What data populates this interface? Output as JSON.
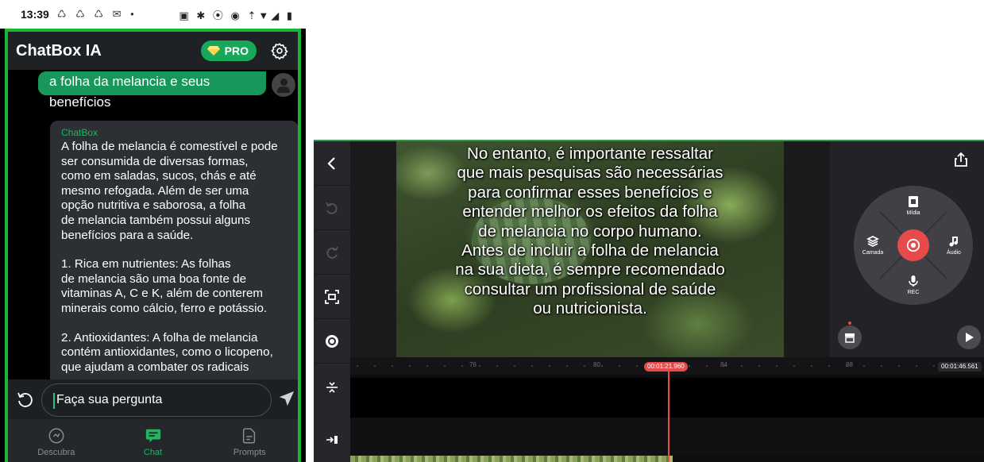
{
  "phone": {
    "status_bar": {
      "time": "13:39",
      "notifications": "♺ ♺ ♺ ✉ •",
      "system": "▣ ✱ ⦿ ◉ ⇡▼◢ ▮"
    },
    "app_bar": {
      "title": "ChatBox IA",
      "pro_label": "PRO"
    },
    "messages": {
      "user": "a folha da melancia e seus benefícios",
      "bot_sender": "ChatBox",
      "bot_paragraphs": [
        "A folha de melancia é comestível e pode\nser consumida de diversas formas,\ncomo em saladas, sucos, chás e até\nmesmo refogada. Além de ser uma\nopção nutritiva e saborosa, a folha\nde melancia também possui alguns\nbenefícios para a saúde.",
        "1. Rica em nutrientes: As folhas\nde melancia são uma boa fonte de\nvitaminas A, C e K, além de conterem\nminerais como cálcio, ferro e potássio.",
        "2. Antioxidantes: A folha de melancia\ncontém antioxidantes, como o licopeno,\nque ajudam a combater os radicais"
      ]
    },
    "input": {
      "placeholder": "Faça sua pergunta"
    },
    "bottom_nav": [
      {
        "label": "Descubra",
        "icon": "compass-icon",
        "active": false
      },
      {
        "label": "Chat",
        "icon": "chat-icon",
        "active": true
      },
      {
        "label": "Prompts",
        "icon": "prompt-document-icon",
        "active": false
      }
    ],
    "colors": {
      "accent_green": "#18b636",
      "message_green": "#17985a",
      "bot_bubble": "#2c2f33"
    }
  },
  "editor": {
    "caption_lines": [
      "No entanto, é importante ressaltar",
      "que mais pesquisas são necessárias",
      "para confirmar esses benefícios e",
      "entender melhor os efeitos da folha",
      "de melancia no corpo humano.",
      "Antes de incluir a folha de melancia",
      "na sua dieta, é sempre recomendado",
      "consultar um profissional de saúde",
      "ou nutricionista."
    ],
    "wheel": {
      "media_label": "Mídia",
      "layer_label": "Camada",
      "audio_label": "Áudio",
      "rec_label": "REC"
    },
    "timeline": {
      "tick_labels": [
        "76",
        "80",
        "84",
        "88"
      ],
      "playhead_time": "00:01:21.960",
      "end_time": "00:01:46.561"
    },
    "colors": {
      "record_red": "#e64a4a",
      "panel_dark": "#232327"
    }
  }
}
